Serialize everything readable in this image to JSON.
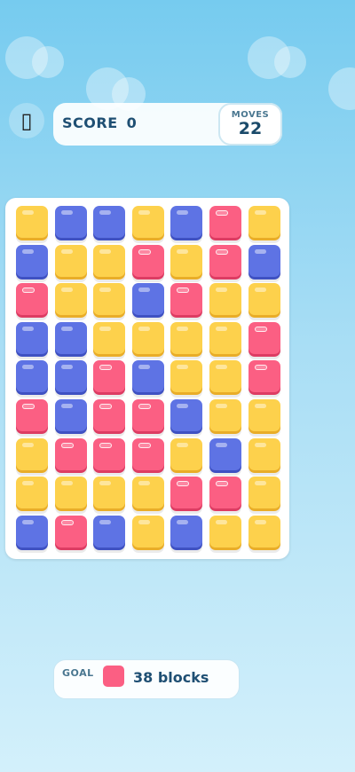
{
  "hud": {
    "menu_icon": "image-placeholder-icon",
    "score_label": "SCORE",
    "score_value": "0",
    "moves_label": "MOVES",
    "moves_value": "22"
  },
  "colors": {
    "yellow": "#fdd14c",
    "blue": "#5e73e4",
    "pink": "#fb5f83"
  },
  "board": {
    "rows": [
      [
        "yellow",
        "blue",
        "blue",
        "yellow",
        "blue",
        "pink",
        "yellow"
      ],
      [
        "blue",
        "yellow",
        "yellow",
        "pink",
        "yellow",
        "pink",
        "blue"
      ],
      [
        "pink",
        "yellow",
        "yellow",
        "blue",
        "pink",
        "yellow",
        "yellow"
      ],
      [
        "blue",
        "blue",
        "yellow",
        "yellow",
        "yellow",
        "yellow",
        "pink"
      ],
      [
        "blue",
        "blue",
        "pink",
        "blue",
        "yellow",
        "yellow",
        "pink"
      ],
      [
        "pink",
        "blue",
        "pink",
        "pink",
        "blue",
        "yellow",
        "yellow"
      ],
      [
        "yellow",
        "pink",
        "pink",
        "pink",
        "yellow",
        "blue",
        "yellow"
      ],
      [
        "yellow",
        "yellow",
        "yellow",
        "yellow",
        "pink",
        "pink",
        "yellow"
      ],
      [
        "blue",
        "pink",
        "blue",
        "yellow",
        "blue",
        "yellow",
        "yellow"
      ]
    ]
  },
  "goal": {
    "label": "GOAL",
    "color": "#fb5f83",
    "text": "38 blocks"
  }
}
